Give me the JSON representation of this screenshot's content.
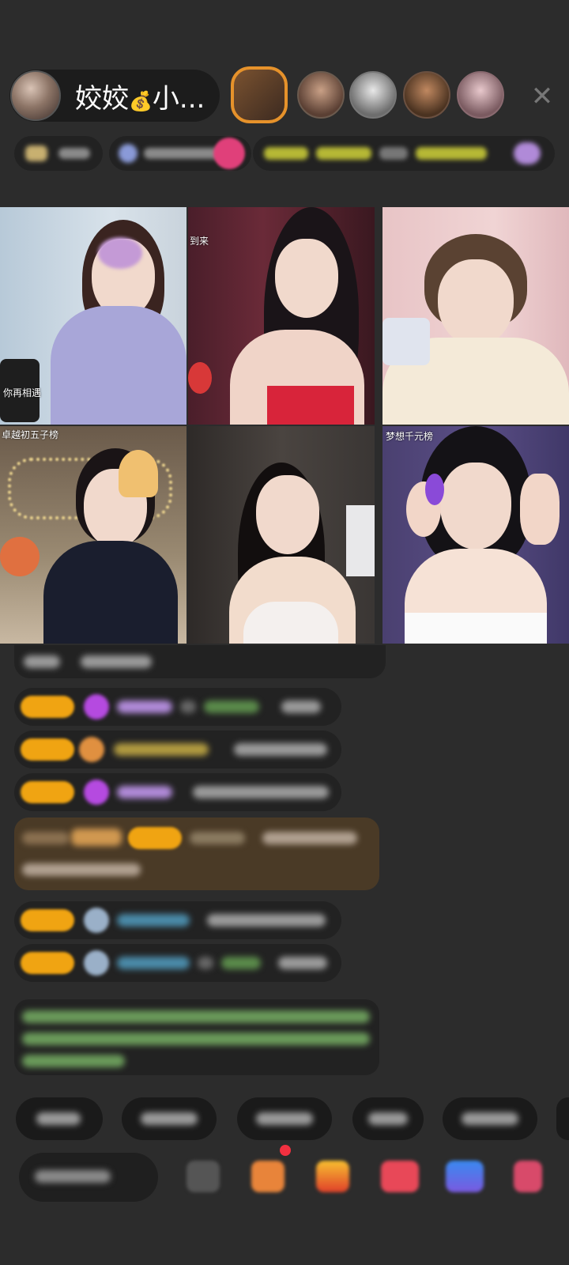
{
  "header": {
    "host_name": "姣姣",
    "host_name_suffix": "小...",
    "money_bag_icon": "money-bag-icon",
    "close_icon": "close-icon"
  },
  "grid": {
    "cells": [
      {
        "label": "你再相遇"
      },
      {
        "label": "到来"
      },
      {
        "label": ""
      },
      {
        "label": "卓越初五子榜"
      },
      {
        "label": ""
      },
      {
        "label": "梦想千元榜"
      }
    ]
  },
  "colors": {
    "background": "#2c2c2c",
    "badge": "#f0a412",
    "accent_orange": "#e6922b"
  }
}
